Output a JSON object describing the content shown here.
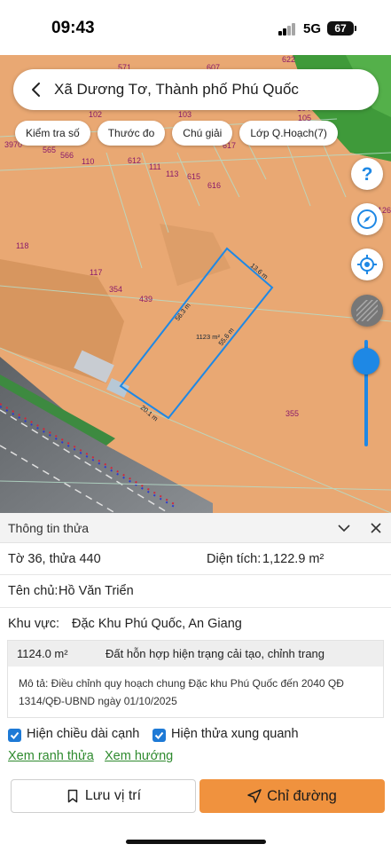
{
  "status_bar": {
    "time": "09:43",
    "network": "5G",
    "battery": "67"
  },
  "search": {
    "location": "Xã Dương Tơ, Thành phố Phú Quốc"
  },
  "chips": [
    "Kiểm tra số",
    "Thước đo",
    "Chú giải",
    "Lớp Q.Hoạch(7)"
  ],
  "map": {
    "parcel_numbers": [
      "571",
      "607",
      "622",
      "102",
      "103",
      "104",
      "105",
      "3970",
      "565",
      "566",
      "110",
      "612",
      "111",
      "113",
      "615",
      "616",
      "617",
      "126",
      "118",
      "117",
      "354",
      "439",
      "355"
    ],
    "edge_lengths": [
      "13.6 m",
      "56.3 m",
      "55.6 m",
      "20.1 m"
    ],
    "parcel_area": "1123 m²",
    "colors": {
      "land": "#e9a873",
      "parcel_outline": "#1e88e5",
      "parcel_label": "#8a1a6a",
      "accent": "#f0923e"
    },
    "zoom_level": 0.8,
    "icons": [
      "help-icon",
      "compass-icon",
      "locate-icon",
      "layers-icon"
    ]
  },
  "info_panel": {
    "title": "Thông tin thửa",
    "lot": "Tờ 36, thửa 440",
    "area_label": "Diện tích:",
    "area_value": "1,122.9 m²",
    "owner_label": "Tên chủ:",
    "owner_value": "Hồ Văn Triển",
    "zone_label": "Khu vực:",
    "zone_value": "Đặc Khu Phú Quốc, An Giang",
    "plan": {
      "area": "1124.0 m²",
      "type": "Đất hỗn hợp hiện trạng cải tạo, chỉnh trang",
      "description": "Mô tả: Điều chỉnh quy hoạch chung Đặc khu Phú Quốc đến 2040 QĐ 1314/QĐ-UBND ngày 01/10/2025"
    },
    "checkboxes": [
      {
        "label": "Hiện chiều dài cạnh",
        "checked": true
      },
      {
        "label": "Hiện thửa xung quanh",
        "checked": true
      }
    ],
    "links": [
      "Xem ranh thửa",
      "Xem hướng"
    ],
    "buttons": {
      "save": "Lưu vị trí",
      "route": "Chỉ đường"
    }
  }
}
